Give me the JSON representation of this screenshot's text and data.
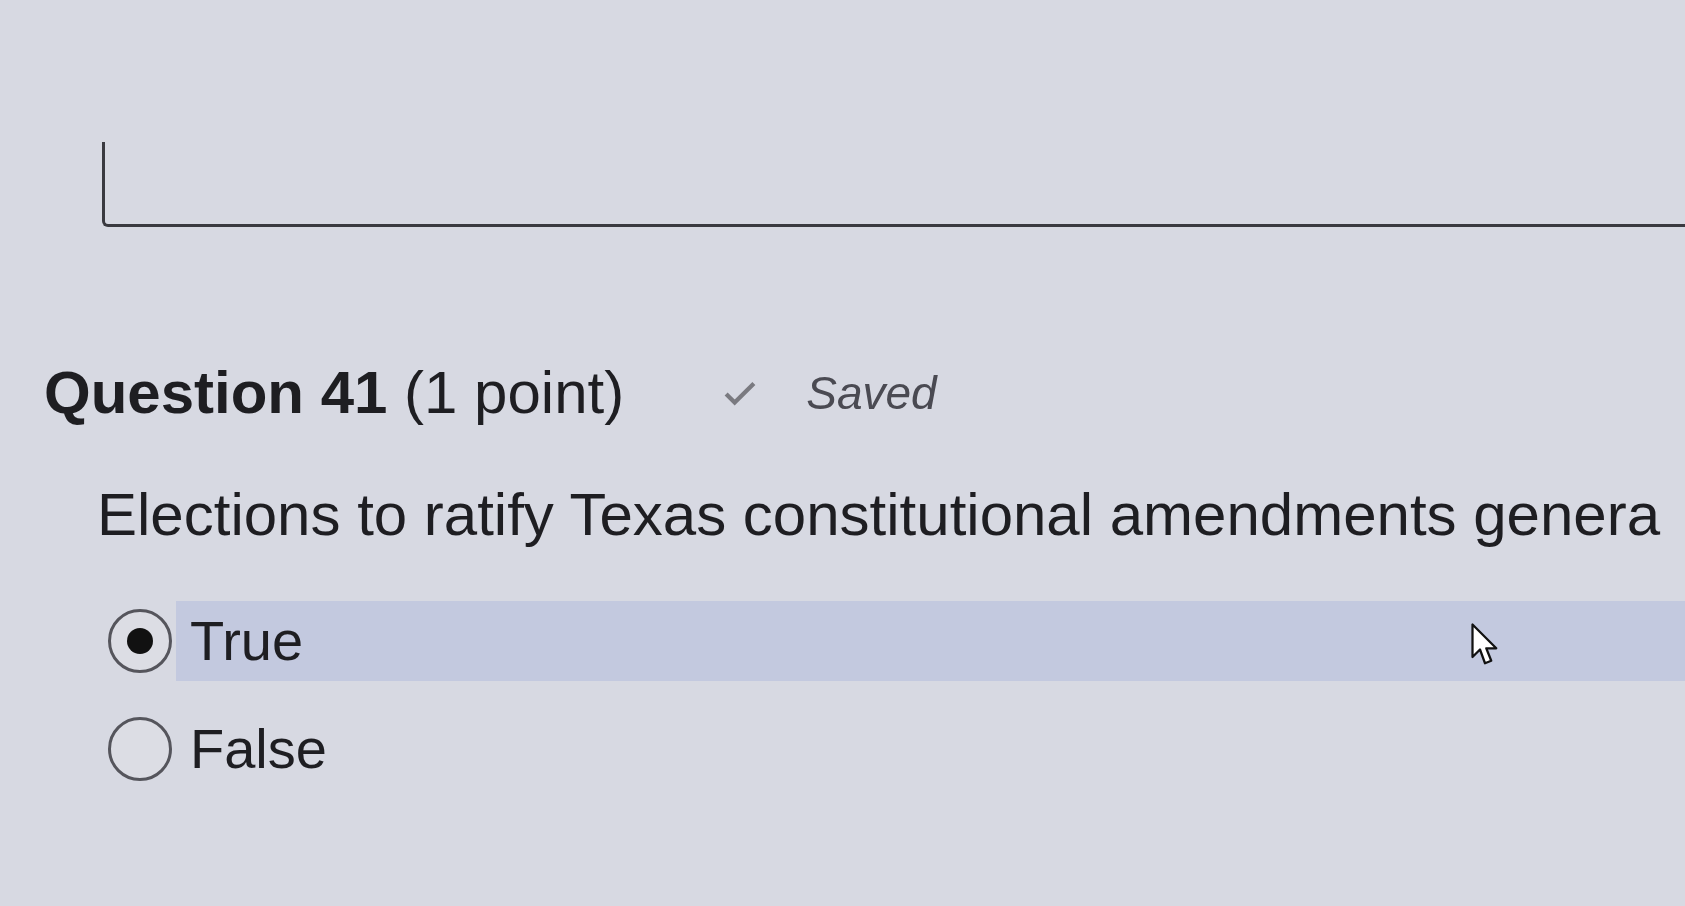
{
  "question": {
    "title": "**Question 41** (1 point)",
    "save_status": {
      "saved": true,
      "label": "Saved"
    },
    "text": "Elections to ratify Texas constitutional amendments genera",
    "options": [
      {
        "label": "True",
        "selected": true,
        "hovered": true
      },
      {
        "label": "False",
        "selected": false,
        "hovered": false
      }
    ]
  }
}
